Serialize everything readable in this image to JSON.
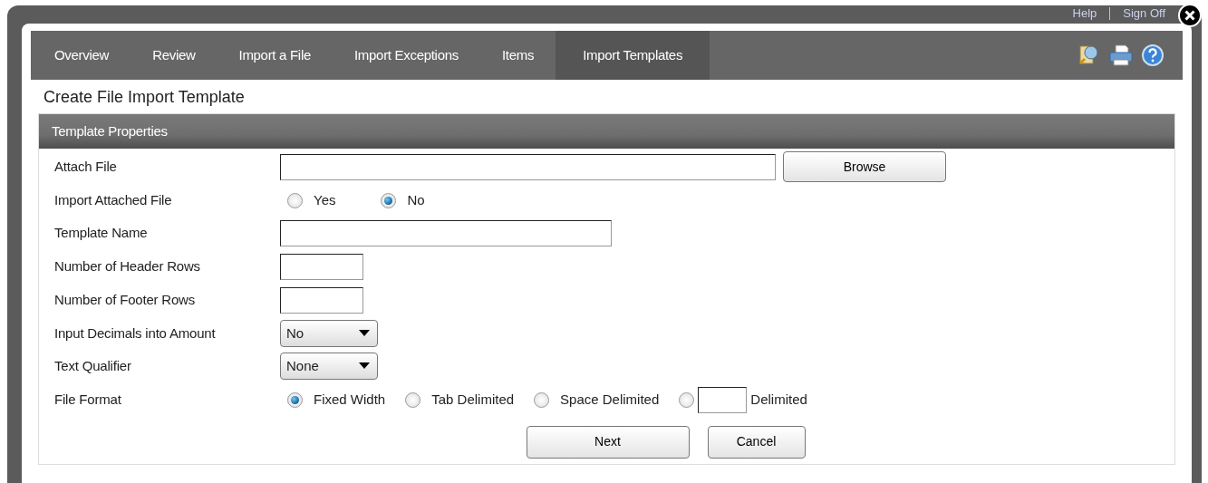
{
  "header_links": [
    "Help",
    "Sign Off"
  ],
  "tabs": [
    {
      "label": "Overview",
      "selected": false
    },
    {
      "label": "Review",
      "selected": false
    },
    {
      "label": "Import a File",
      "selected": false
    },
    {
      "label": "Import Exceptions",
      "selected": false
    },
    {
      "label": "Items",
      "selected": false
    },
    {
      "label": "Import Templates",
      "selected": true
    }
  ],
  "page_title": "Create File Import Template",
  "section": {
    "title": "Template Properties"
  },
  "fields": [
    {
      "kind": "file",
      "label": "Attach File",
      "button": "Browse"
    },
    {
      "kind": "radio",
      "label": "Import Attached File",
      "options": [
        {
          "label": "Yes",
          "selected": false
        },
        {
          "label": "No",
          "selected": true
        }
      ]
    },
    {
      "kind": "text",
      "label": "Template Name"
    },
    {
      "kind": "number",
      "label": "Number of Header Rows"
    },
    {
      "kind": "number",
      "label": "Number of Footer Rows"
    },
    {
      "kind": "select",
      "label": "Input Decimals into Amount",
      "value": "No"
    },
    {
      "kind": "select",
      "label": "Text Qualifier",
      "value": "None"
    },
    {
      "kind": "radio",
      "label": "File Format",
      "options": [
        {
          "label": "Fixed Width",
          "selected": true
        },
        {
          "label": "Tab Delimited",
          "selected": false
        },
        {
          "label": "Space Delimited",
          "selected": false
        },
        {
          "label": "Delimited",
          "selected": false,
          "kind": "custom"
        }
      ]
    }
  ],
  "buttons": [
    "Next",
    "Cancel"
  ]
}
